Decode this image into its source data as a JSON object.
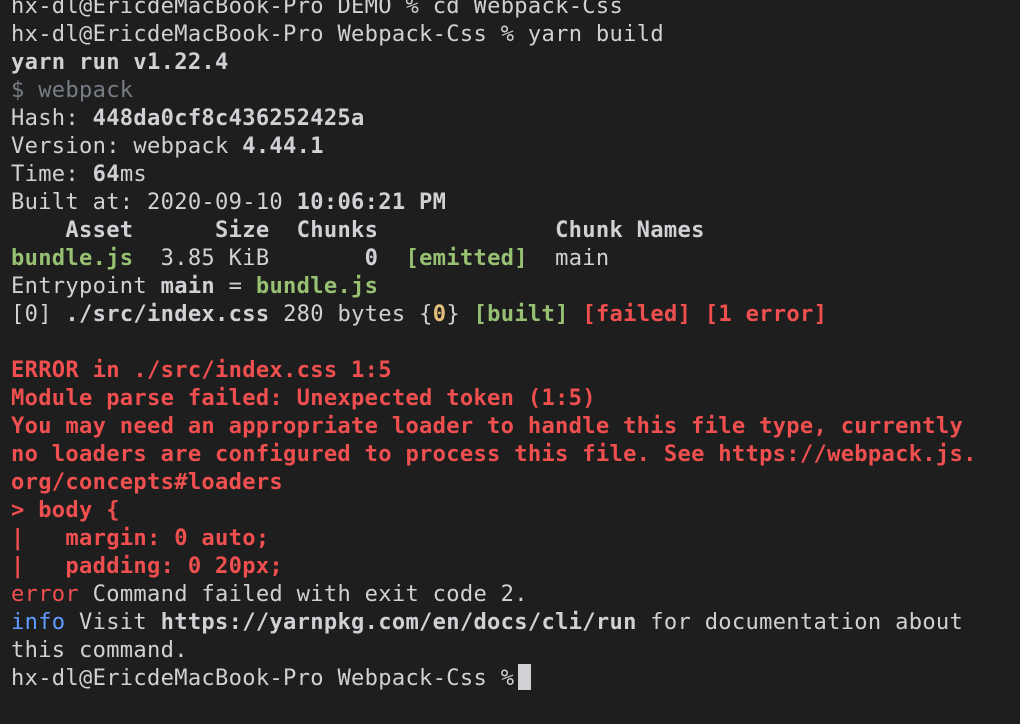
{
  "terminal": {
    "prompt_host": "hx-dl@EricdeMacBook-Pro",
    "line0": {
      "dir": "DEMO",
      "prompt_symbol": "%",
      "cmd": "cd Webpack-Css"
    },
    "line1": {
      "dir": "Webpack-Css",
      "prompt_symbol": "%",
      "cmd": "yarn build"
    },
    "yarn_run": "yarn run v1.22.4",
    "webpack_cmd": "$ webpack",
    "hash": {
      "label": "Hash: ",
      "value": "448da0cf8c436252425a"
    },
    "version": {
      "label": "Version: webpack ",
      "value": "4.44.1"
    },
    "time": {
      "label": "Time: ",
      "value": "64",
      "unit": "ms"
    },
    "built_at": {
      "label": "Built at: ",
      "date": "2020-09-10",
      "time": "10:06:21 PM"
    },
    "asset_table": {
      "headers": [
        "Asset",
        "Size",
        "Chunks",
        "Chunk Names"
      ],
      "row": {
        "asset": "bundle.js",
        "size": "3.85 KiB",
        "chunks": "0",
        "status": "[emitted]",
        "chunk_names": "main"
      }
    },
    "entrypoint": {
      "label": "Entrypoint ",
      "name": "main",
      "eq": " = ",
      "file": "bundle.js"
    },
    "module": {
      "id": "[0]",
      "path": "./src/index.css",
      "size": "280 bytes",
      "chunk_open": "{",
      "chunk_id": "0",
      "chunk_close": "}",
      "built": "[built]",
      "failed": "[failed]",
      "errors": "[1 error]"
    },
    "error_block": [
      "ERROR in ./src/index.css 1:5",
      "Module parse failed: Unexpected token (1:5)",
      "You may need an appropriate loader to handle this file type, currently",
      "no loaders are configured to process this file. See https://webpack.js.",
      "org/concepts#loaders",
      "> body {",
      "|   margin: 0 auto;",
      "|   padding: 0 20px;"
    ],
    "error_line": {
      "tag": "error",
      "text": " Command failed with exit code 2."
    },
    "info_line": {
      "tag": "info",
      "pre": " Visit ",
      "url": "https://yarnpkg.com/en/docs/cli/run",
      "post": " for documentation about",
      "cont": "this command."
    },
    "final_prompt": {
      "dir": "Webpack-Css",
      "prompt_symbol": "%"
    }
  }
}
